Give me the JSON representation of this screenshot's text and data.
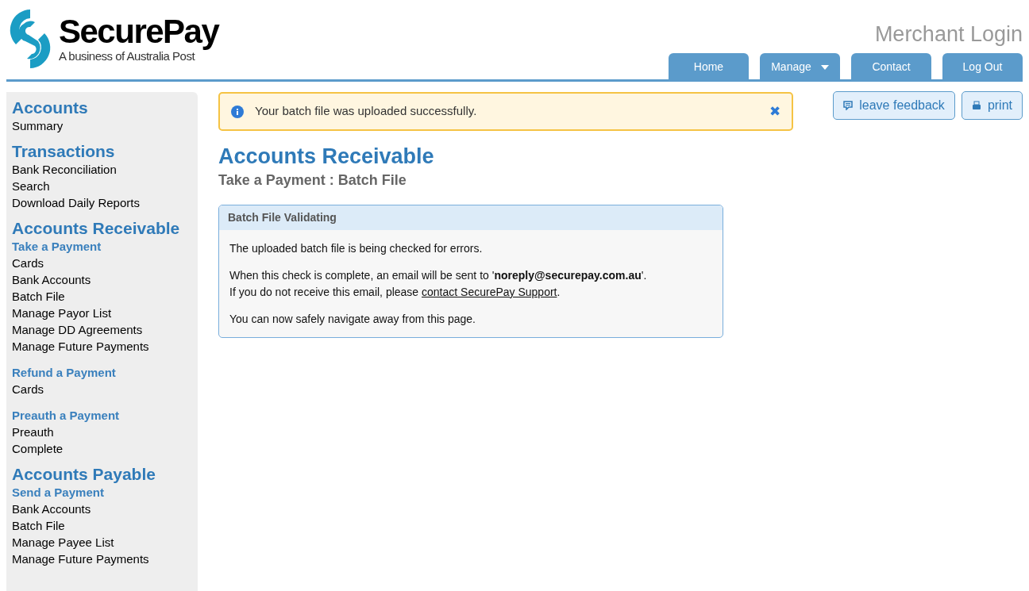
{
  "header": {
    "brand": "SecurePay",
    "tagline": "A business of Australia Post",
    "portal_title": "Merchant Login"
  },
  "nav_tabs": [
    {
      "label": "Home",
      "has_menu": false
    },
    {
      "label": "Manage",
      "has_menu": true
    },
    {
      "label": "Contact",
      "has_menu": false
    },
    {
      "label": "Log Out",
      "has_menu": false
    }
  ],
  "sidebar": [
    {
      "title": "Accounts",
      "groups": [
        {
          "items": [
            "Summary"
          ]
        }
      ]
    },
    {
      "title": "Transactions",
      "groups": [
        {
          "items": [
            "Bank Reconciliation",
            "Search",
            "Download Daily Reports"
          ]
        }
      ]
    },
    {
      "title": "Accounts Receivable",
      "groups": [
        {
          "title": "Take a Payment",
          "items": [
            "Cards",
            "Bank Accounts",
            "Batch File",
            "Manage Payor List",
            "Manage DD Agreements",
            "Manage Future Payments"
          ]
        },
        {
          "title": "Refund a Payment",
          "items": [
            "Cards"
          ]
        },
        {
          "title": "Preauth a Payment",
          "items": [
            "Preauth",
            "Complete"
          ]
        }
      ]
    },
    {
      "title": "Accounts Payable",
      "groups": [
        {
          "title": "Send a Payment",
          "items": [
            "Bank Accounts",
            "Batch File",
            "Manage Payee List",
            "Manage Future Payments"
          ]
        }
      ]
    }
  ],
  "alert": {
    "message": "Your batch file was uploaded successfully.",
    "close": "✖"
  },
  "actions": [
    "leave feedback",
    "print"
  ],
  "page": {
    "title": "Accounts Receivable",
    "subtitle": "Take a Payment : Batch File"
  },
  "panel": {
    "title": "Batch File Validating",
    "paragraphs": [
      {
        "text": "The uploaded batch file is being checked for errors."
      },
      {
        "text": "When this check is complete, an email will be sent to '**noreply@securepay.com.au**'.",
        "text2": "If you do not receive this email, please ",
        "link": "contact SecurePay Support",
        "after": "."
      },
      {
        "text": "You can now safely navigate away from this page."
      }
    ]
  }
}
